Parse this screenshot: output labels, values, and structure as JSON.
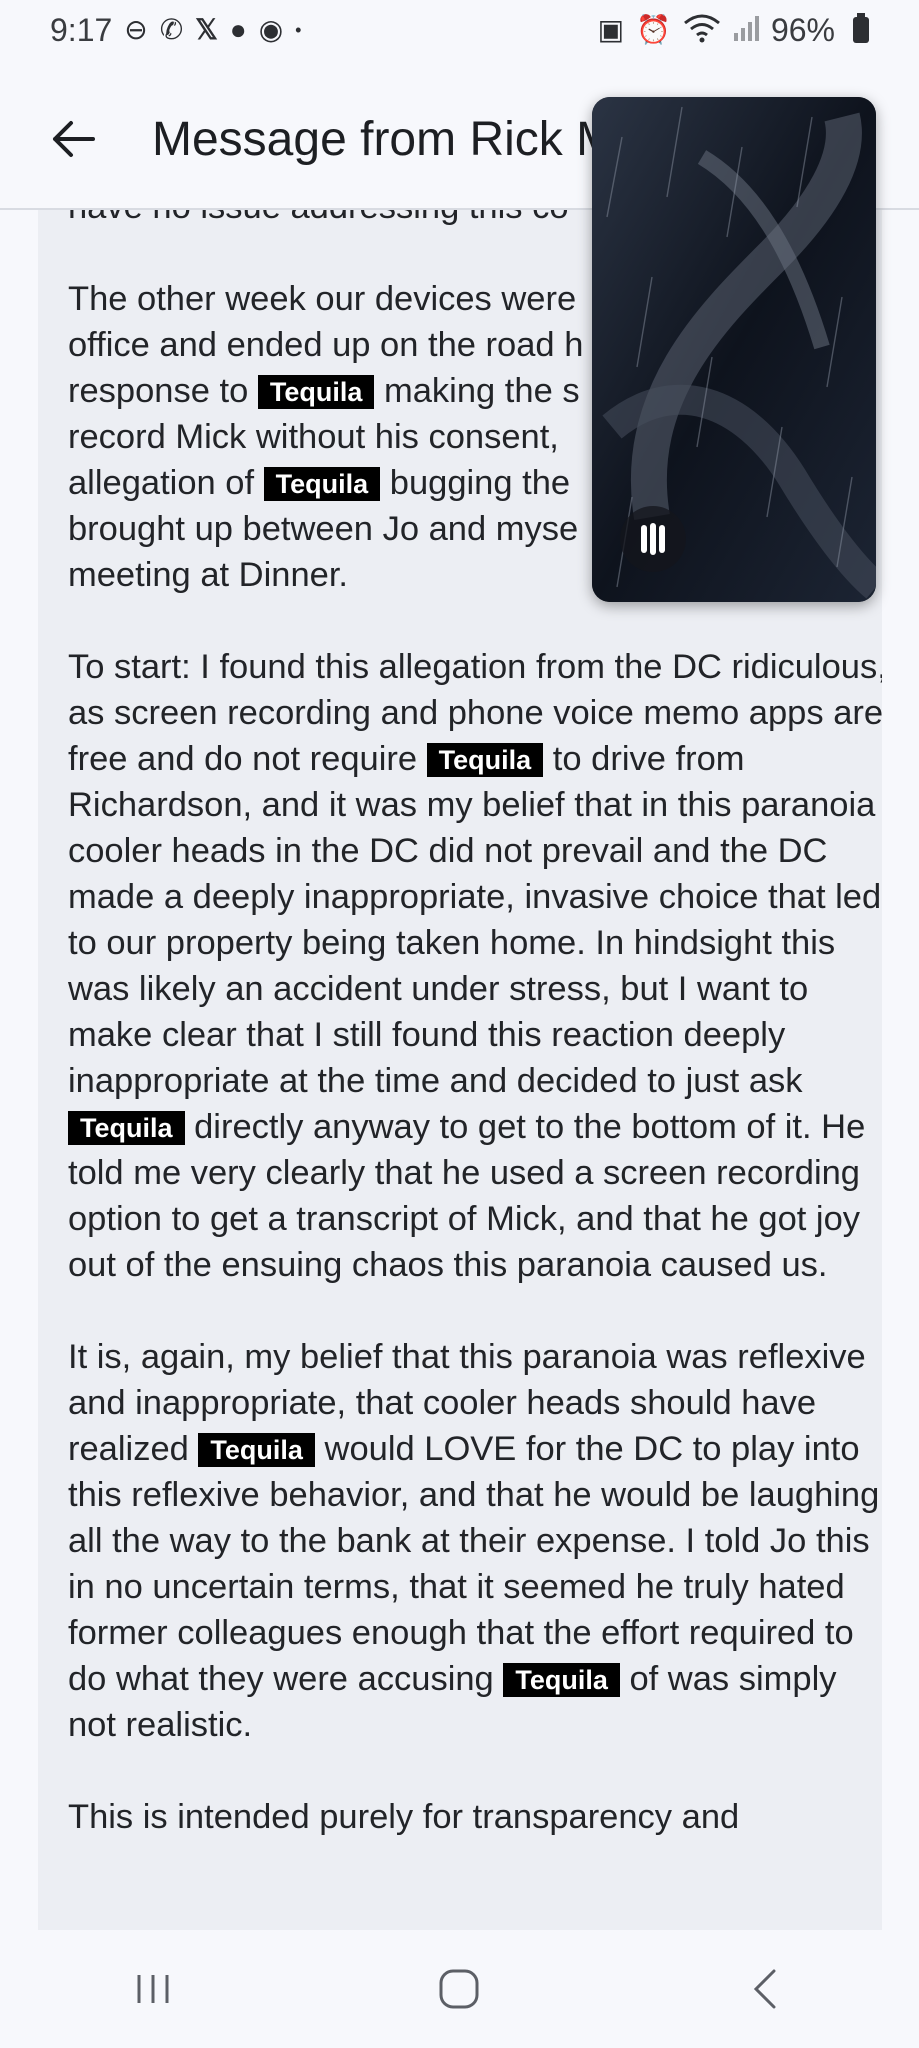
{
  "status_bar": {
    "time": "9:17",
    "left_icons": [
      "minus-circle-icon",
      "call-icon",
      "x-icon",
      "chat-icon",
      "messenger-icon",
      "dot-icon"
    ],
    "right_icons": [
      "nfc-icon",
      "alarm-icon",
      "wifi-icon",
      "signal-icon"
    ],
    "battery": "96%"
  },
  "header": {
    "title": "Message from Rick M"
  },
  "message": {
    "partial_top": "have no issue addressing this co",
    "redaction_label": "Tequila",
    "p1": {
      "l1": "The other week our devices were",
      "l2": "office and ended up on the road h",
      "l3a": "response to",
      "l3b": "making the s",
      "l4": "record Mick without his consent,",
      "l5a": "allegation of",
      "l5b": "bugging the",
      "l6": "brought up between Jo and myse",
      "l7": "meeting at Dinner."
    },
    "p2": {
      "a": "To start: I found this allegation from the DC ridiculous, as screen recording and phone voice memo apps are free and do not require",
      "b": "to drive from Richardson, and it was my belief that in this paranoia cooler heads in the DC did not prevail and the DC made a deeply inappropriate, invasive choice that led to our property being taken home. In hindsight this was likely an accident under stress, but I want to make clear that I still found this reaction deeply inappropriate at the time and decided to just ask",
      "c": "directly anyway to get to the bottom of it. He told me very clearly that he used a screen recording option to get a transcript of Mick, and that he got joy out of the ensuing chaos this paranoia caused us."
    },
    "p3": {
      "a": "It is, again, my belief that this paranoia was reflexive and inappropriate, that cooler heads should have realized",
      "b": "would LOVE for the DC to play into this reflexive behavior, and that he would be laughing all the way to the bank at their expense. I told Jo this in no uncertain terms, that it seemed he truly hated former colleagues enough that the effort required to do what they were accusing",
      "c": "of was simply not realistic."
    },
    "p4": "This is intended purely for transparency and"
  },
  "video_overlay": {
    "state": "playing",
    "control_icon": "pause-icon"
  },
  "nav_bar": {
    "buttons": [
      "recents-icon",
      "home-icon",
      "back-nav-icon"
    ]
  },
  "colors": {
    "background": "#f7f8fc",
    "panel": "#eceef3",
    "redaction": "#000000",
    "text": "#222428"
  }
}
